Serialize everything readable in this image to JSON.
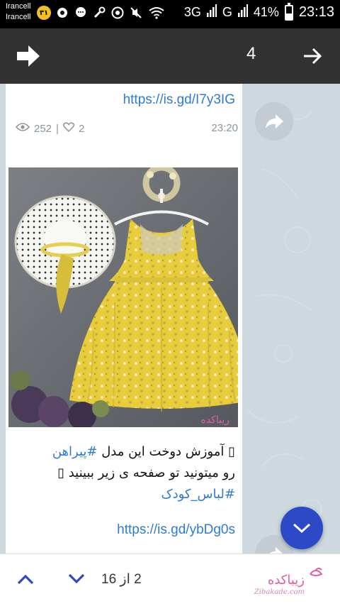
{
  "status_bar": {
    "carrier_1": "Irancell",
    "carrier_2": "Irancell",
    "badge": "۳۱",
    "network_1": "3G",
    "network_2": "G",
    "battery": "41%",
    "battery_level": 0.41,
    "time": "23:13"
  },
  "toolbar": {
    "count": "4"
  },
  "message_1": {
    "link": "https://is.gd/I7y3IG",
    "views": "252",
    "separator": "|",
    "likes": "2",
    "time": "23:20"
  },
  "message_2": {
    "caption_line1_prefix": "▯ آموزش دوخت این مدل ",
    "caption_hashtag1": "#پیراهن",
    "caption_line2": "رو میتونید تو صفحه ی زیر ببینید ▯",
    "caption_hashtag2": "#لباس_کودک",
    "link": "https://is.gd/ybDg0s",
    "watermark": "زیباکده",
    "watermark_sub": "Zibakade.com"
  },
  "bottom_bar": {
    "pager": "2 از 16",
    "brand": "زیباکده",
    "brand_sub": "Zibakade.com"
  },
  "icons": {
    "forward": "forward-icon",
    "arrow": "arrow-right-icon",
    "share": "share-icon",
    "scroll_down": "chevron-down-icon",
    "up": "chevron-up-icon",
    "down": "chevron-down-icon"
  },
  "colors": {
    "accent": "#2c49c8",
    "link": "#2d7bd6",
    "toolbar": "#323232"
  }
}
